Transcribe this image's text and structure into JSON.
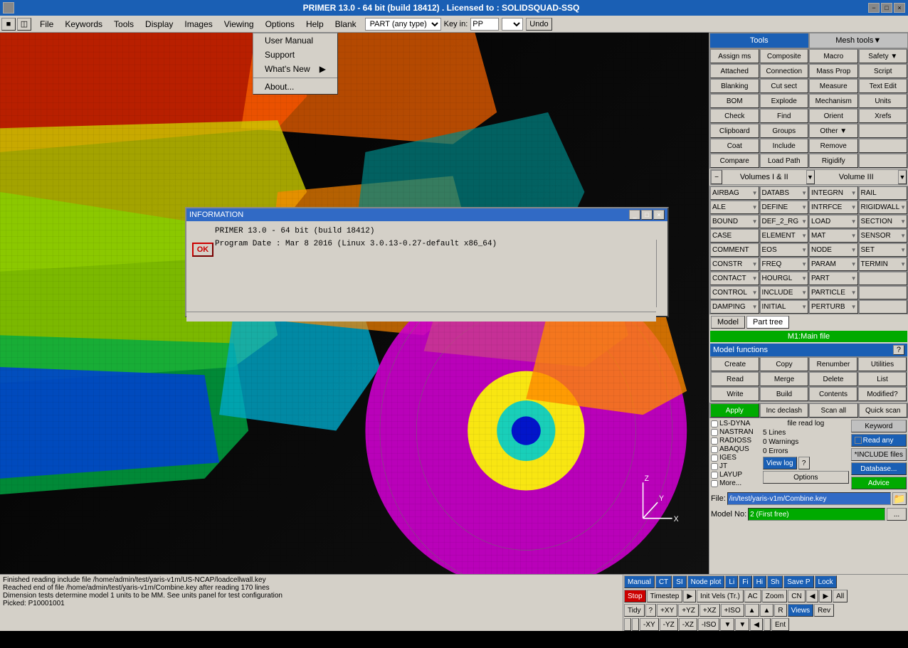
{
  "window": {
    "title": "PRIMER 13.0 - 64 bit (build 18412) . Licensed to : SOLIDSQUAD-SSQ",
    "minimize": "−",
    "maximize": "□",
    "close": "×"
  },
  "menu": {
    "items": [
      "File",
      "Keywords",
      "Tools",
      "Display",
      "Images",
      "Viewing",
      "Options",
      "Help",
      "Blank"
    ]
  },
  "filter": {
    "part_label": "PART (any type)",
    "key_in_label": "Key in:",
    "key_value": "PP",
    "undo_label": "Undo"
  },
  "help_menu": {
    "items": [
      "User Manual",
      "Support",
      "What's New",
      "About..."
    ]
  },
  "right_panel": {
    "tools_tab": "Tools",
    "mesh_tab": "Mesh tools",
    "tool_buttons": [
      "Assign ms",
      "Composite",
      "Macro",
      "Safety",
      "Attached",
      "Connection",
      "Mass Prop",
      "Script",
      "Blanking",
      "Cut sect",
      "Measure",
      "Text Edit",
      "BOM",
      "Explode",
      "Mechanism",
      "Units",
      "Check",
      "Find",
      "Orient",
      "Xrefs",
      "Clipboard",
      "Groups",
      "Other",
      "Coat",
      "Include",
      "Remove",
      "Compare",
      "Load Path",
      "Rigidify"
    ],
    "volumes": {
      "label": "Volumes I & II",
      "vol3": "Volume III"
    },
    "keywords": [
      "AIRBAG",
      "DATABS",
      "INTEGRN",
      "RAIL",
      "ALE",
      "DEFINE",
      "INTRFCE",
      "RIGIDWALL",
      "BOUND",
      "DEF_2_RG",
      "LOAD",
      "SECTION",
      "CASE",
      "ELEMENT",
      "MAT",
      "SENSOR",
      "COMMENT",
      "EOS",
      "NODE",
      "SET",
      "CONSTR",
      "FREQ",
      "PARAM",
      "TERMIN",
      "CONTACT",
      "HOURGL",
      "PART",
      "CONTROL",
      "INCLUDE",
      "PARTICLE",
      "DAMPING",
      "INITIAL",
      "PERTURB"
    ],
    "model_btn": "Model",
    "part_tree_btn": "Part tree",
    "main_file": "M1:Main file",
    "model_functions": {
      "title": "Model functions",
      "help": "?",
      "buttons": [
        "Create",
        "Copy",
        "Renumber",
        "Utilities",
        "Read",
        "Merge",
        "Delete",
        "List",
        "Write",
        "Build",
        "Contents",
        "Modified?"
      ]
    },
    "apply_row": [
      "Apply",
      "Inc declash",
      "Scan all",
      "Quick scan"
    ],
    "file_options": {
      "checkboxes": [
        "LS-DYNA",
        "NASTRAN",
        "RADIOSS",
        "ABAQUS",
        "IGES",
        "JT",
        "LAYUP",
        "More..."
      ],
      "log_title": "file read log",
      "lines": "5 Lines",
      "warnings": "0 Warnings",
      "errors": "0 Errors",
      "view_log": "View log",
      "help_q": "?",
      "keyword_btn": "Keyword",
      "read_any": "Read any",
      "include_files": "*INCLUDE files",
      "options_btn": "Options",
      "database_btn": "Database...",
      "advice_btn": "Advice"
    },
    "file_row": {
      "label": "File:",
      "value": "/in/test/yaris-v1m/Combine.key",
      "folder_icon": "📁"
    },
    "model_no_row": {
      "label": "Model No:",
      "value": "2 (First free)",
      "btn": "..."
    }
  },
  "dialog": {
    "title": "INFORMATION",
    "ok_label": "OK",
    "line1": "PRIMER 13.0 - 64 bit (build 18412)",
    "line2": "Program Date : Mar  8 2016  (Linux 3.0.13-0.27-default x86_64)"
  },
  "status_bar": {
    "lines": [
      "Finished reading include file /home/admin/test/yaris-v1m/US-NCAP/loadcellwall.key",
      "Reached end of file /home/admin/test/yaris-v1m/Combine.key after reading 170 lines",
      "Dimension tests determine model 1 units to be MM. See units panel for test configuration",
      "Picked: P10001001"
    ]
  },
  "bottom_controls": {
    "row1": {
      "manual": "Manual",
      "ct": "CT",
      "si": "SI",
      "node_plot": "Node plot",
      "li": "Li",
      "fi": "Fi",
      "hi": "Hi",
      "sh": "Sh",
      "save_p": "Save P",
      "lock": "Lock"
    },
    "row2": {
      "stop": "Stop",
      "timestep": "Timestep",
      "arrow": "▶",
      "init_vels": "Init Vels (Tr.)",
      "ac": "AC",
      "zoom": "Zoom",
      "cn": "CN",
      "nav1": "◀",
      "nav2": "▶",
      "all": "All"
    },
    "row3": {
      "tidy": "Tidy",
      "q": "?",
      "plus_xy": "+XY",
      "plus_yz": "+YZ",
      "plus_xz": "+XZ",
      "plus_iso": "+ISO",
      "up": "▲",
      "rot_up": "▲",
      "r": "R",
      "views": "Views",
      "rev": "Rev"
    },
    "row4": {
      "minus_xy": "-XY",
      "minus_yz": "-YZ",
      "minus_xz": "-XZ",
      "minus_iso": "-ISO",
      "down": "▼",
      "rot_down": "▼",
      "left": "◀",
      "ent": "Ent"
    }
  },
  "colors": {
    "blue_dark": "#1a5fb4",
    "green": "#00aa00",
    "red": "#cc0000",
    "bg": "#d4d0c8",
    "title_blue": "#316ac5"
  }
}
